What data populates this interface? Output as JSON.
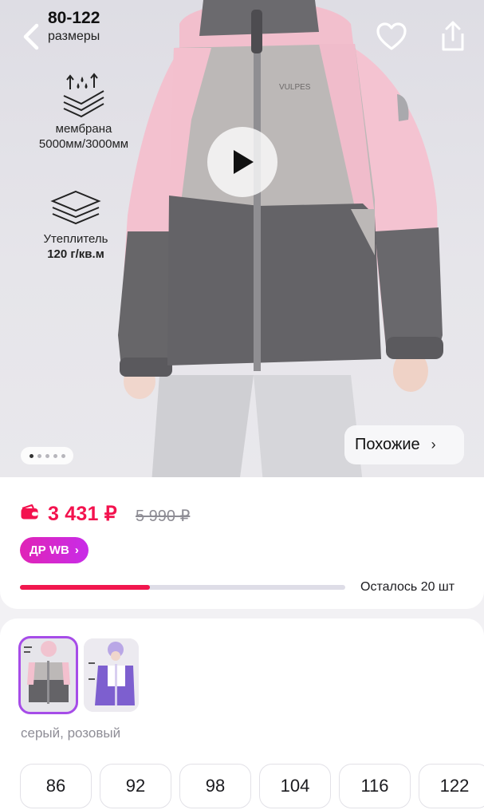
{
  "header": {
    "size_range": "80-122",
    "size_caption": "размеры",
    "back_icon": "chevron-left-icon",
    "favorite_icon": "heart-icon",
    "share_icon": "share-icon"
  },
  "gallery": {
    "brand_on_jacket": "VULPES",
    "features": [
      {
        "icon": "membrane-icon",
        "line1": "мембрана",
        "line2": "5000мм/3000мм"
      },
      {
        "icon": "insulation-layers-icon",
        "line1": "Утеплитель",
        "line2": "120 г/кв.м"
      }
    ],
    "play_icon": "play-icon",
    "slide_count": 5,
    "active_slide": 1,
    "similar_label": "Похожие",
    "similar_chevron": "›"
  },
  "price": {
    "wallet_icon": "wallet-icon",
    "current": "3 431 ₽",
    "old": "5 990 ₽",
    "badge_label": "ДР WB",
    "badge_chevron": "›",
    "stock_text": "Осталось 20 шт",
    "stock_fraction": 0.4,
    "accent_color": "#f3124e",
    "badge_color": "#d629c9"
  },
  "variants": {
    "color_name": "серый, розовый",
    "thumbnails": [
      {
        "name": "grey-pink",
        "selected": true
      },
      {
        "name": "purple",
        "selected": false
      }
    ],
    "sizes": [
      "86",
      "92",
      "98",
      "104",
      "116",
      "122"
    ]
  }
}
